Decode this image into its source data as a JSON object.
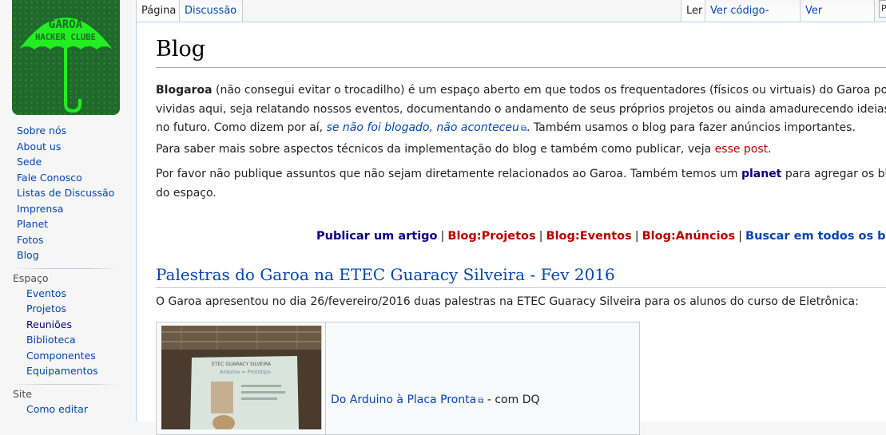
{
  "logo": {
    "line1": "GAROA",
    "line2": "HACKER CLUBE"
  },
  "sidebar": {
    "main": [
      {
        "label": "Sobre nós"
      },
      {
        "label": "About us"
      },
      {
        "label": "Sede"
      },
      {
        "label": "Fale Conosco"
      },
      {
        "label": "Listas de Discussão"
      },
      {
        "label": "Imprensa"
      },
      {
        "label": "Planet"
      },
      {
        "label": "Fotos"
      },
      {
        "label": "Blog"
      }
    ],
    "espaco_heading": "Espaço",
    "espaco": [
      {
        "label": "Eventos"
      },
      {
        "label": "Projetos"
      },
      {
        "label": "Reuniões"
      },
      {
        "label": "Biblioteca"
      },
      {
        "label": "Componentes"
      },
      {
        "label": "Equipamentos"
      }
    ],
    "site_heading": "Site",
    "site": [
      {
        "label": "Como editar"
      }
    ]
  },
  "tabs": {
    "left": [
      {
        "label": "Página"
      },
      {
        "label": "Discussão"
      }
    ],
    "right": [
      {
        "label": "Ler"
      },
      {
        "label": "Ver código-fonte"
      },
      {
        "label": "Ver histórico"
      }
    ],
    "search_stub": "P"
  },
  "page": {
    "title": "Blog",
    "intro": {
      "bold": "Blogaroa",
      "line1": " (não consegui evitar o trocadilho) é um espaço aberto em que todos os frequentadores (físicos ou virtuais) do Garoa pode",
      "line2": "vividas aqui, seja relatando nossos eventos, documentando o andamento de seus próprios projetos ou ainda amadurecendo ideias c",
      "line3_pre": "no futuro. Como dizem por aí, ",
      "line3_link": "se não foi blogado, não aconteceu",
      "line3_post": ". Também usamos o blog para fazer anúncios importantes."
    },
    "tech": {
      "pre": "Para saber mais sobre aspectos técnicos da implementação do blog e também como publicar, veja ",
      "link": "esse post",
      "post": "."
    },
    "scope": {
      "line1_pre": "Por favor não publique assuntos que não sejam diretamente relacionados ao Garoa. Também temos um ",
      "line1_link": "planet",
      "line1_post": " para agregar os blog",
      "line2": "do espaço."
    },
    "nav_links": [
      {
        "label": "Publicar um artigo",
        "style": "dark"
      },
      {
        "label": "Blog:Projetos",
        "style": "red"
      },
      {
        "label": "Blog:Eventos",
        "style": "red"
      },
      {
        "label": "Blog:Anúncios",
        "style": "red"
      },
      {
        "label": "Buscar em todos os blog",
        "style": "blue"
      }
    ],
    "nav_separator": "|",
    "section": {
      "title": "Palestras do Garoa na ETEC Guaracy Silveira - Fev 2016",
      "text": "O Garoa apresentou no dia 26/fevereiro/2016 duas palestras na ETEC Guaracy Silveira para os alunos do curso de Eletrônica:",
      "slide_line1": "ETEC GUARACY SILVEIRA",
      "slide_line2": "Arduino = Protótipo",
      "caption_link": "Do Arduino à Placa Pronta",
      "caption_post": " - com DQ"
    }
  },
  "colors": {
    "link": "#0645ad",
    "redlink": "#ba0000",
    "visited_dark": "#0b0080",
    "logo_green": "#1f6a2a",
    "logo_bright": "#22ee22"
  }
}
